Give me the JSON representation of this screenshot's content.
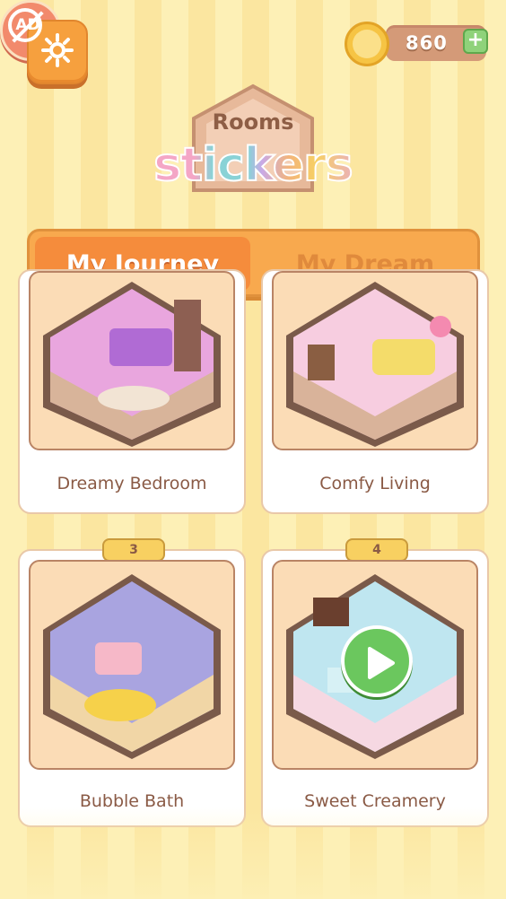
{
  "header": {
    "coins": "860",
    "plus_label": "+",
    "noads_label": "AD"
  },
  "logo": {
    "rooms": "Rooms",
    "stickers": "stickers"
  },
  "tabs": [
    {
      "label": "My Journey",
      "selected": true
    },
    {
      "label": "My Dream",
      "selected": false
    }
  ],
  "rooms": [
    {
      "name": "Dreamy Bedroom",
      "badge": ""
    },
    {
      "name": "Comfy Living",
      "badge": ""
    },
    {
      "name": "Bubble Bath",
      "badge": "3"
    },
    {
      "name": "Sweet Creamery",
      "badge": "4"
    }
  ],
  "colors": {
    "accent": "#f58c3c",
    "tab_bar": "#f8a94e",
    "play": "#6bc75e",
    "coin": "#f6c444"
  }
}
